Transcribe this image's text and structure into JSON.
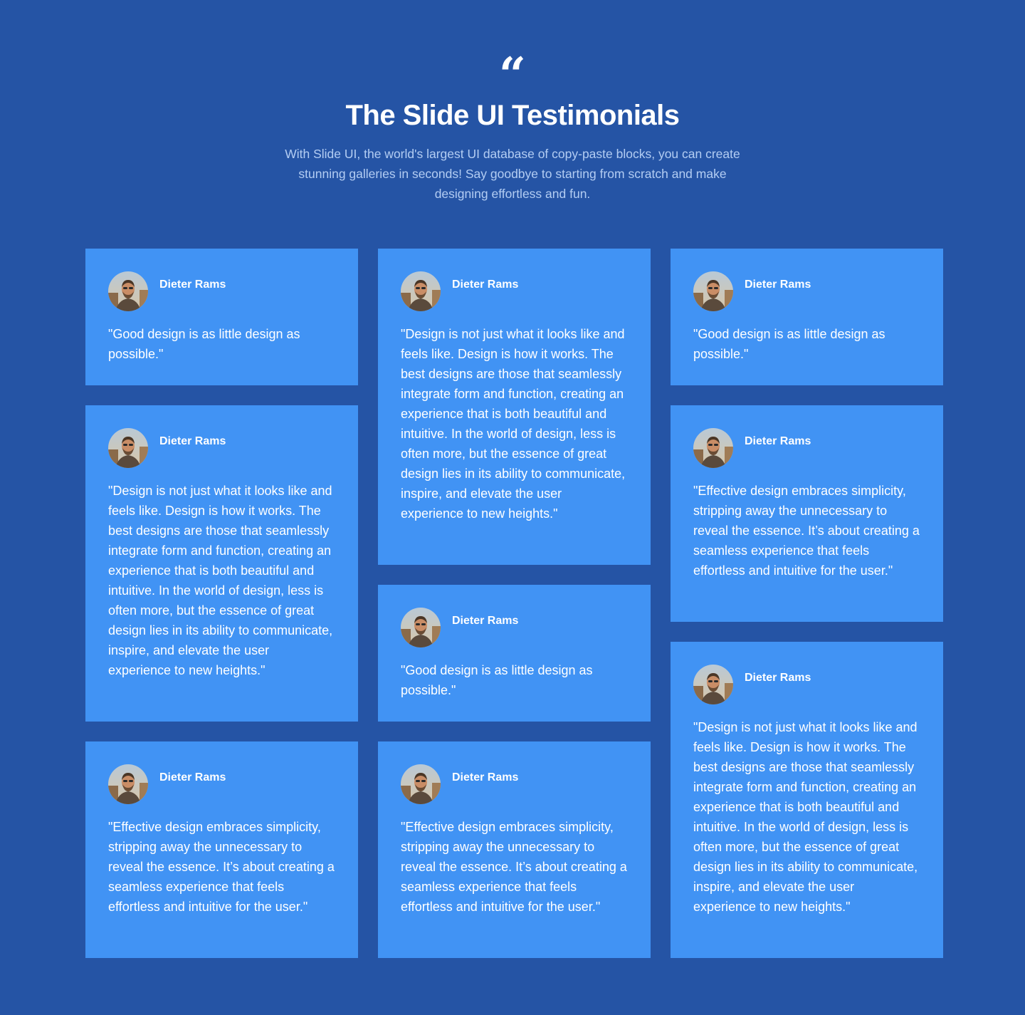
{
  "header": {
    "quote_glyph": "“",
    "title": "The Slide UI Testimonials",
    "subtitle": "With Slide UI, the world's largest UI database of copy-paste blocks, you can create stunning galleries in seconds! Say goodbye to starting from scratch and make designing effortless and fun."
  },
  "colors": {
    "background": "#2554a5",
    "card": "#4193f4",
    "text": "#ffffff",
    "subtitle": "#b3cdf3"
  },
  "columns": [
    {
      "cards": [
        {
          "name": "Dieter Rams",
          "avatar_icon": "person-photo",
          "quote": "\"Good design is as little design as possible.\""
        },
        {
          "name": "Dieter Rams",
          "avatar_icon": "person-photo",
          "quote": "\"Design is not just what it looks like and feels like. Design is how it works. The best designs are those that seamlessly integrate form and function, creating an experience that is both beautiful and intuitive. In the world of design, less is often more, but the essence of great design lies in its ability to communicate, inspire, and elevate the user experience to new heights.\""
        },
        {
          "name": "Dieter Rams",
          "avatar_icon": "person-photo",
          "quote": "\"Effective design embraces simplicity, stripping away the unnecessary to reveal the essence. It’s about creating a seamless experience that feels effortless and intuitive for the user.\""
        }
      ]
    },
    {
      "cards": [
        {
          "name": "Dieter Rams",
          "avatar_icon": "person-photo",
          "quote": "\"Design is not just what it looks like and feels like. Design is how it works. The best designs are those that seamlessly integrate form and function, creating an experience that is both beautiful and intuitive. In the world of design, less is often more, but the essence of great design lies in its ability to communicate, inspire, and elevate the user experience to new heights.\""
        },
        {
          "name": "Dieter Rams",
          "avatar_icon": "person-photo",
          "quote": "\"Good design is as little design as possible.\""
        },
        {
          "name": "Dieter Rams",
          "avatar_icon": "person-photo",
          "quote": "\"Effective design embraces simplicity, stripping away the unnecessary to reveal the essence. It’s about creating a seamless experience that feels effortless and intuitive for the user.\""
        }
      ]
    },
    {
      "cards": [
        {
          "name": "Dieter Rams",
          "avatar_icon": "person-photo",
          "quote": "\"Good design is as little design as possible.\""
        },
        {
          "name": "Dieter Rams",
          "avatar_icon": "person-photo",
          "quote": "\"Effective design embraces simplicity, stripping away the unnecessary to reveal the essence. It’s about creating a seamless experience that feels effortless and intuitive for the user.\""
        },
        {
          "name": "Dieter Rams",
          "avatar_icon": "person-photo",
          "quote": "\"Design is not just what it looks like and feels like. Design is how it works. The best designs are those that seamlessly integrate form and function, creating an experience that is both beautiful and intuitive. In the world of design, less is often more, but the essence of great design lies in its ability to communicate, inspire, and elevate the user experience to new heights.\""
        }
      ]
    }
  ]
}
